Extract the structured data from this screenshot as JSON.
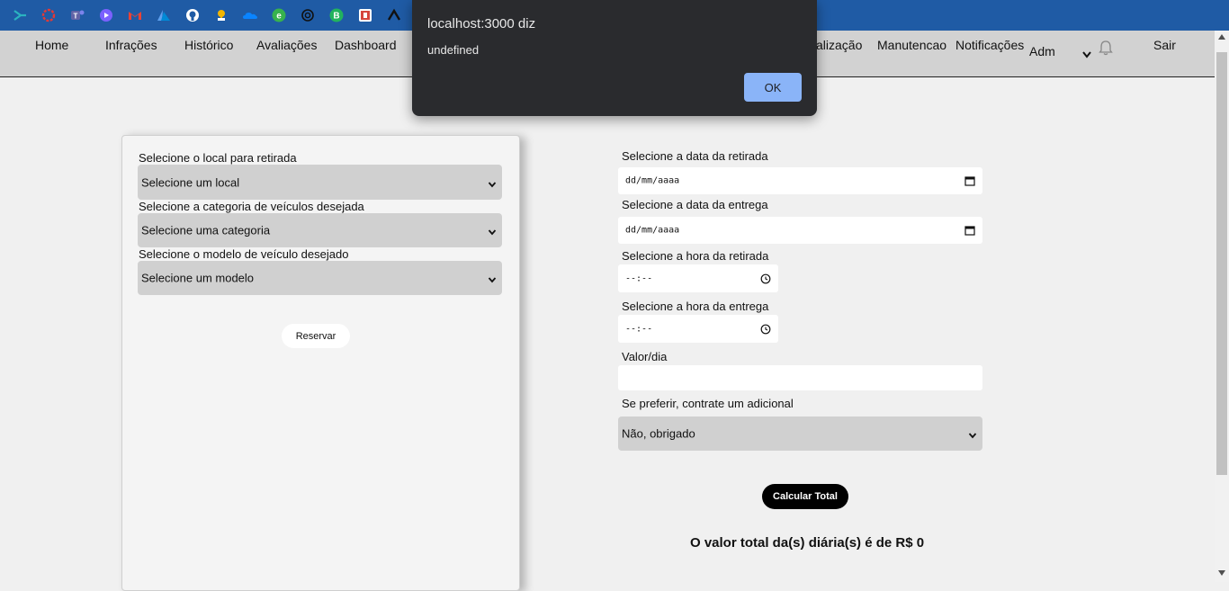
{
  "bookmarks": [
    {
      "icon": "arrow-icon",
      "color": "#2bb3c0"
    },
    {
      "icon": "ring-icon",
      "color": "#e53935"
    },
    {
      "icon": "teams-icon",
      "color": "#6264a7"
    },
    {
      "icon": "clipchamp-icon",
      "color": "#7b61ff"
    },
    {
      "icon": "gmail-icon",
      "color": "#ea4335"
    },
    {
      "icon": "azure-icon",
      "color": "#0089d6"
    },
    {
      "icon": "github-icon",
      "color": "#ffffff"
    },
    {
      "icon": "trophy-icon",
      "color": "#f2b600"
    },
    {
      "icon": "onedrive-icon",
      "color": "#0a84ff"
    },
    {
      "icon": "e-icon",
      "color": "#37b24d"
    },
    {
      "icon": "openai-icon",
      "color": "#ffffff"
    },
    {
      "icon": "b-icon",
      "color": "#22b35e"
    },
    {
      "icon": "photo-icon",
      "color": "#d6453d"
    },
    {
      "icon": "lambda-icon",
      "color": "#111111"
    }
  ],
  "nav": {
    "items": [
      "Home",
      "Infrações",
      "Histórico",
      "Avaliações",
      "Dashboard",
      "calização",
      "Manutencao",
      "Notificações"
    ],
    "user": "Adm",
    "logout": "Sair"
  },
  "left_form": {
    "local_label": "Selecione o local para retirada",
    "local_value": "Selecione um local",
    "categoria_label": "Selecione a categoria de veículos desejada",
    "categoria_value": "Selecione uma categoria",
    "modelo_label": "Selecione o modelo de veículo desejado",
    "modelo_value": "Selecione um modelo",
    "reserve_button": "Reservar"
  },
  "right_form": {
    "data_retirada_label": "Selecione a data da retirada",
    "data_retirada_placeholder": "dd/mm/aaaa",
    "data_entrega_label": "Selecione a data da entrega",
    "data_entrega_placeholder": "dd/mm/aaaa",
    "hora_retirada_label": "Selecione a hora da retirada",
    "hora_retirada_placeholder": "--:--",
    "hora_entrega_label": "Selecione a hora da entrega",
    "hora_entrega_placeholder": "--:--",
    "valor_dia_label": "Valor/dia",
    "valor_dia_value": "",
    "adicional_label": "Se preferir, contrate um adicional",
    "adicional_value": "Não, obrigado",
    "calc_button": "Calcular Total",
    "total_text": "O valor total da(s) diária(s) é de R$ 0"
  },
  "dialog": {
    "title": "localhost:3000 diz",
    "message": "undefined",
    "ok_button": "OK"
  }
}
